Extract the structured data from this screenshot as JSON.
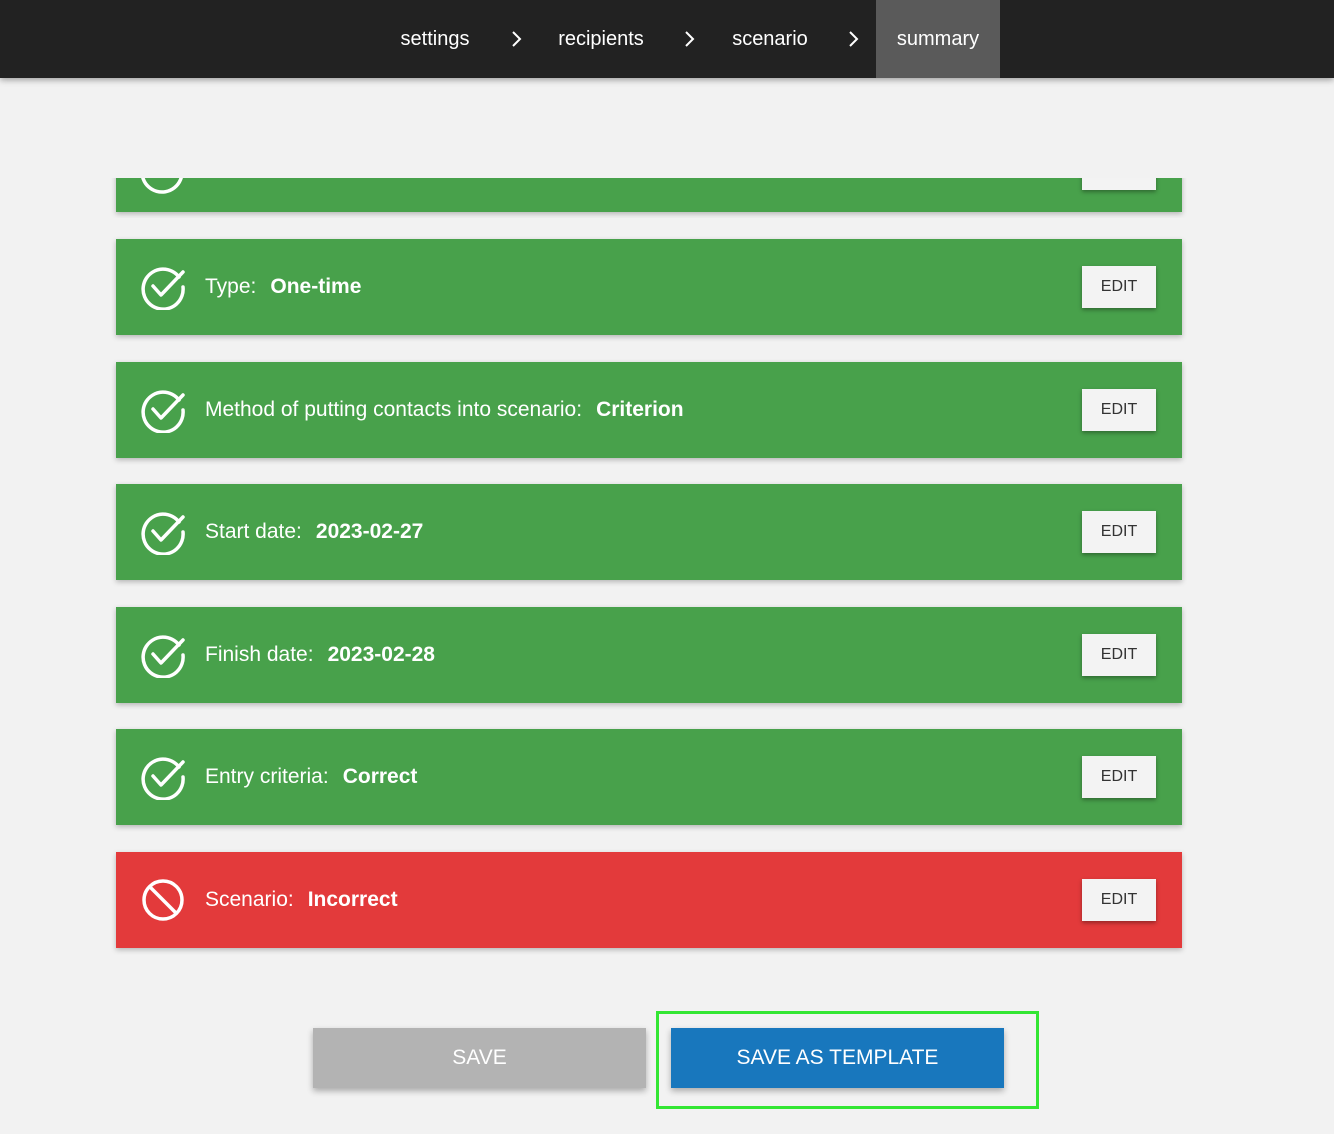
{
  "nav": {
    "steps": [
      "settings",
      "recipients",
      "scenario",
      "summary"
    ],
    "active": "summary"
  },
  "summary": {
    "rows": [
      {
        "label": "Type:",
        "value": "One-time",
        "status": "ok"
      },
      {
        "label": "Method of putting contacts into scenario:",
        "value": "Criterion",
        "status": "ok"
      },
      {
        "label": "Start date:",
        "value": "2023-02-27",
        "status": "ok"
      },
      {
        "label": "Finish date:",
        "value": "2023-02-28",
        "status": "ok"
      },
      {
        "label": "Entry criteria:",
        "value": "Correct",
        "status": "ok"
      },
      {
        "label": "Scenario:",
        "value": "Incorrect",
        "status": "error"
      }
    ],
    "edit_label": "EDIT"
  },
  "actions": {
    "save_label": "SAVE",
    "save_template_label": "SAVE AS TEMPLATE"
  },
  "colors": {
    "ok": "#48a14b",
    "error": "#e33a3b",
    "primary": "#1877bd",
    "disabled": "#b3b3b3",
    "highlight": "#33e633"
  }
}
